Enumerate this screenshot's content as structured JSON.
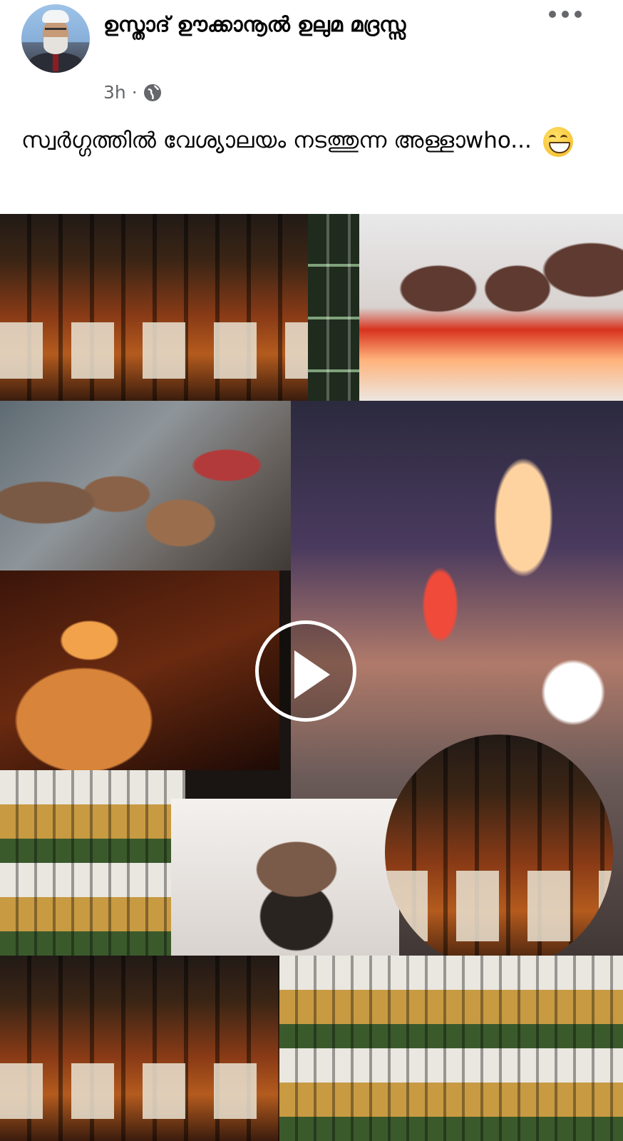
{
  "post": {
    "author": "ഉസ്താദ് ഊക്കാനൂൽ ഉലുമ മദ്രസ്സ",
    "time": "3h",
    "separator": "·",
    "privacy_icon": "globe-icon",
    "more_icon": "more-horizontal-icon",
    "caption": "സ്വർഗ്ഗത്തിൽ വേശ്യാലയം നടത്തുന്ന അള്ളാwho...",
    "emoji": "grinning-face-icon"
  },
  "media": {
    "type": "video",
    "play_icon": "play-icon"
  },
  "colors": {
    "text": "#050505",
    "secondary": "#65676b",
    "background": "#ffffff"
  }
}
